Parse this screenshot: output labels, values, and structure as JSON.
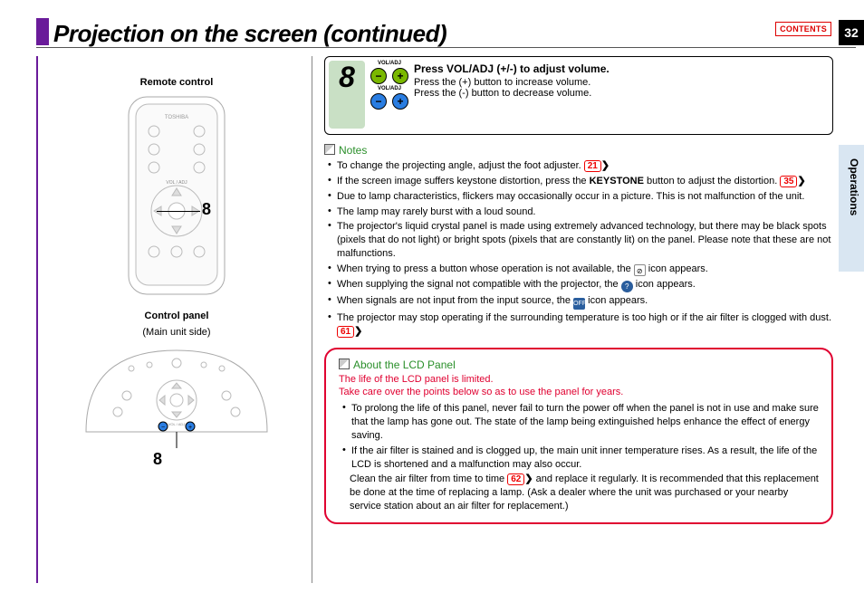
{
  "page": {
    "title": "Projection on the screen (continued)",
    "contents_btn": "CONTENTS",
    "number": "32",
    "side_tab": "Operations"
  },
  "left": {
    "remote_label": "Remote control",
    "control_panel_label": "Control panel",
    "control_panel_sub": "(Main unit side)",
    "remote_brand": "TOSHIBA",
    "vol_label": "VOL / ADJ",
    "callout": "8"
  },
  "step": {
    "number": "8",
    "vol_label": "VOL/ADJ",
    "title": "Press VOL/ADJ (+/-) to adjust volume.",
    "line1": "Press the (+) button to increase volume.",
    "line2": "Press the (-) button to decrease volume."
  },
  "notes": {
    "heading": "Notes",
    "items": [
      {
        "pre": "To change the projecting angle, adjust the foot adjuster. ",
        "ref": "21"
      },
      {
        "pre": "If the screen image suffers keystone distortion, press the ",
        "bold": "KEYSTONE",
        "post": " button to adjust the distortion. ",
        "ref": "35"
      },
      {
        "pre": "Due to lamp characteristics, flickers may occasionally occur in a picture. This is not malfunction of the unit."
      },
      {
        "pre": "The lamp may rarely burst with a loud sound."
      },
      {
        "pre": "The projector's liquid crystal panel is made using extremely advanced technology, but there may be black spots (pixels that do not light) or bright spots (pixels that are constantly lit) on the panel. Please note that these are not malfunctions."
      },
      {
        "pre": "When trying to press a button whose operation is not available, the ",
        "icon": "no",
        "post": " icon appears."
      },
      {
        "pre": "When supplying the signal not compatible with the projector, the ",
        "icon": "q",
        "post": " icon appears."
      },
      {
        "pre": "When signals are not input from the input source, the ",
        "icon": "off",
        "post": " icon appears."
      },
      {
        "pre": "The projector may stop operating if the surrounding temperature is too high or if the air filter is clogged with dust. ",
        "ref": "61"
      }
    ]
  },
  "warning": {
    "heading": "About the LCD Panel",
    "sub1": "The life of the LCD panel is limited.",
    "sub2": "Take care over the points below so as to use the panel for years.",
    "items": [
      "To prolong the life of this panel, never fail to turn the power off when the panel is not in use and make sure that the lamp has gone out. The state of the lamp being extinguished helps enhance the effect of energy saving.",
      "If the air filter is stained and is clogged up, the main unit inner temperature rises. As a result, the life of the LCD is shortened and a malfunction may also occur."
    ],
    "clean_pre": "Clean the air filter from time to time ",
    "clean_ref": "62",
    "clean_post": " and replace it regularly. It is recommended that this replacement be done at the time of replacing a lamp. (Ask a dealer where the unit was purchased or your nearby service station about an air filter for replacement.)"
  }
}
